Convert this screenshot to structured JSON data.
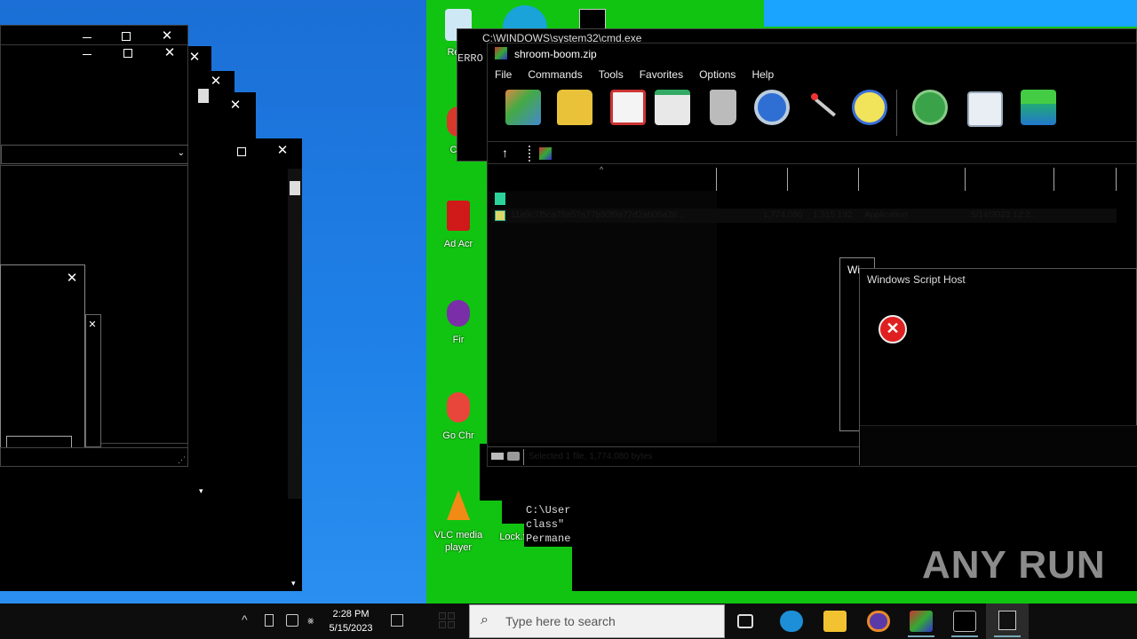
{
  "desktop": {
    "icons": [
      {
        "label": "Recy",
        "name": "recycle-bin"
      },
      {
        "label": "CCI",
        "name": "ccleaner"
      },
      {
        "label": "Ad Acr",
        "name": "adobe-acrobat"
      },
      {
        "label": "Fir",
        "name": "firefox"
      },
      {
        "label": "Go Chr",
        "name": "google-chrome"
      },
      {
        "label": "VLC media player",
        "name": "vlc"
      },
      {
        "label": "Lock.f",
        "name": "lock-file"
      }
    ]
  },
  "cmd": {
    "title": "C:\\WINDOWS\\system32\\cmd.exe",
    "lines": [
      "C:\\User",
      "class\"",
      "Permane"
    ],
    "err_fragment": "ERRO"
  },
  "winrar": {
    "title": "shroom-boom.zip",
    "menu": [
      "File",
      "Commands",
      "Tools",
      "Favorites",
      "Options",
      "Help"
    ],
    "status": "Selected 1 file, 1,774,080 bytes",
    "file_row": {
      "name": "11a9c7f5ca78a57a77b30f9a77d2ab06a28...",
      "size": "1,774,080",
      "packed": "1,315,192",
      "type": "Application",
      "modified": "5/14/2023 12:2..."
    }
  },
  "wsh": {
    "title": "Windows Script Host",
    "behind_title": "Wi"
  },
  "taskbar": {
    "search_placeholder": "Type here to search",
    "time": "2:28 PM",
    "date": "5/15/2023"
  },
  "watermark": "ANY RUN",
  "colors": {
    "green_desktop": "#11c411",
    "blue_desktop": "#1f82e8",
    "error_red": "#e02020"
  }
}
